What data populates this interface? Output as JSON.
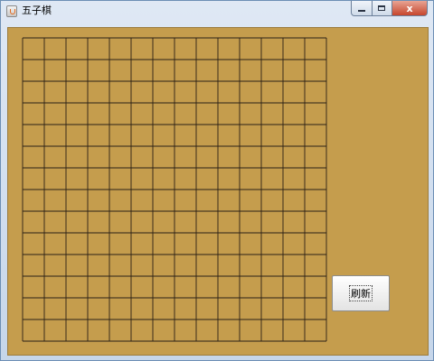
{
  "window": {
    "title": "五子棋",
    "caption": {
      "close_label": "x"
    }
  },
  "board": {
    "lines_per_side": 15,
    "line_color": "#2b2116",
    "background_color": "#c59d4d"
  },
  "refresh_label": "刷新"
}
